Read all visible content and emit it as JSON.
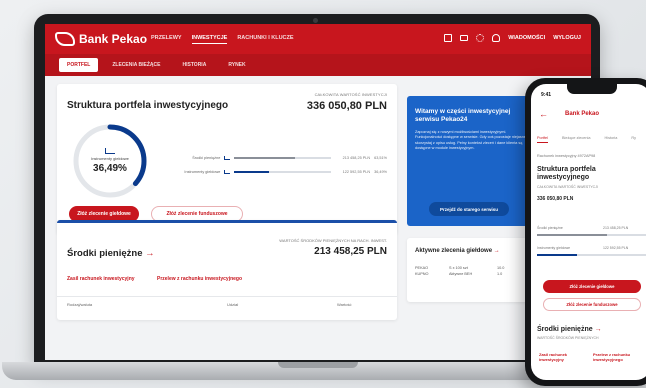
{
  "app": {
    "brand": "Bank Pekao",
    "nav": [
      "PRZELEWY",
      "INWESTYCJE",
      "RACHUNKI I KLUCZE"
    ],
    "nav_active": "INWESTYCJE",
    "top_right": [
      "WIADOMOŚCI",
      "WYLOGUJ"
    ],
    "subtabs": [
      "PORTFEL",
      "ZLECENIA BIEŻĄCE",
      "HISTORIA",
      "RYNEK"
    ],
    "subtab_active": "PORTFEL"
  },
  "portfolio": {
    "title": "Struktura portfela inwestycyjnego",
    "total_label": "CAŁKOWITA WARTOŚĆ INWESTYCJI",
    "total_value": "336 050,80 PLN",
    "donut_label": "Instrumenty giełdowe",
    "donut_pct": "36,49%",
    "donut_fraction": 0.3649,
    "allocations": [
      {
        "name": "Środki pieniężne",
        "amount": "213 458,25 PLN",
        "pct": "63,51%",
        "fraction": 0.6351,
        "color": "#8a8f98"
      },
      {
        "name": "Instrumenty giełdowe",
        "amount": "122 592,55 PLN",
        "pct": "36,49%",
        "fraction": 0.3649,
        "color": "#0a3a8c"
      }
    ],
    "btn_primary": "Złóż zlecenie giełdowe",
    "btn_secondary": "Złóż zlecenie funduszowe"
  },
  "cash": {
    "title": "Środki pieniężne",
    "arrow": "→",
    "total_label": "WARTOŚĆ ŚRODKÓW PIENIĘŻNYCH NA RACH. INWEST.",
    "total_value": "213 458,25 PLN",
    "link1": "Zasil rachunek inwestycyjny",
    "link2": "Przelew z rachunku inwestycyjnego",
    "columns": [
      "Rodzaj/waluta",
      "Udział",
      "Wartość"
    ]
  },
  "promo": {
    "title": "Witamy w części inwestycyjnej serwisu Pekao24",
    "text": "Zapoznaj się z nowymi możliwościami inwestycyjnymi. Funkcjonalności dostępne w serwisie. Gdy coś pozostaje niejasne, skorzystaj z opisu usług. Pełny kontekst zleceń i dane klienta są dostępne w module inwestycyjnym.",
    "button": "Przejdź do starego serwisu"
  },
  "orders": {
    "title": "Aktywne zlecenia giełdowe",
    "arrow": "→",
    "row": [
      "PEKAO",
      "S x 100 szt",
      "10.0"
    ],
    "row2": [
      "KUPNO",
      "Aktywne BEH",
      "1.0"
    ]
  },
  "phone": {
    "time": "9:41",
    "logo": "Bank Pekao",
    "tabs": [
      "Portfel",
      "Bieżące zlecenia",
      "Historia",
      "Ry"
    ],
    "account": "Rachunek inwestycyjny 4972AP98",
    "title": "Struktura portfela inwestycyjnego",
    "sub": "CAŁKOWITA WARTOŚĆ INWESTYCJI",
    "total": "336 050,80 PLN",
    "bar1_label": "Środki pieniężne",
    "bar1_amount": "213 458,25 PLN",
    "bar2_label": "Instrumenty giełdowe",
    "bar2_amount": "122 592,55 PLN",
    "btn_primary": "Złóż zlecenie giełdowe",
    "btn_secondary": "Złóż zlecenie funduszowe",
    "cash_title": "Środki pieniężne",
    "cash_sub": "WARTOŚĆ ŚRODKÓW PIENIĘŻNYCH",
    "link1": "Zasil rachunek inwestycyjny",
    "link2": "Przelew z rachunku inwestycyjnego"
  },
  "colors": {
    "brand_red": "#c8161e",
    "accent_blue": "#1b64c8",
    "navy": "#0a3a8c"
  },
  "icons": [
    "search-icon",
    "mail-icon",
    "gear-icon",
    "user-icon",
    "chart-icon",
    "back-arrow-icon"
  ]
}
